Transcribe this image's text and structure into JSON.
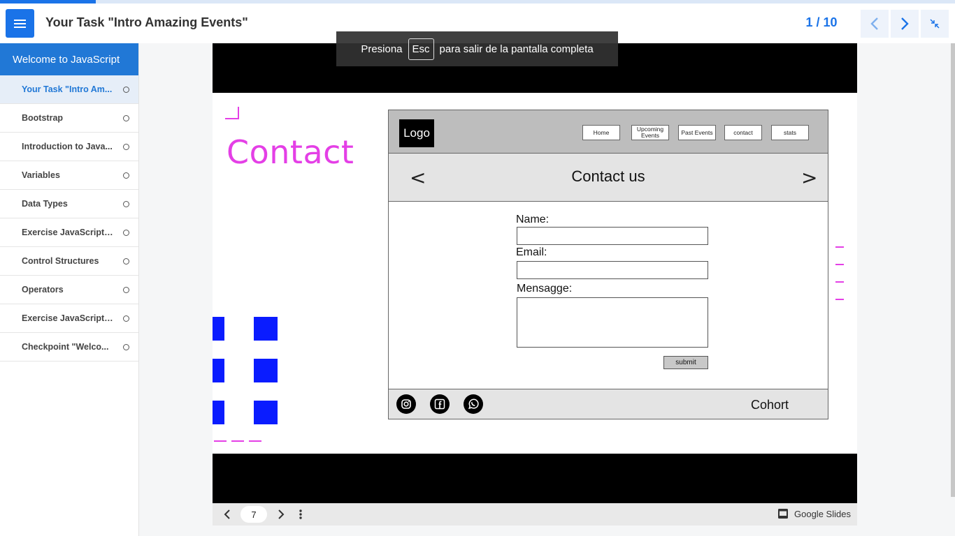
{
  "course_progress": {
    "value_percent": 10
  },
  "header": {
    "title": "Your Task \"Intro Amazing Events\"",
    "page_counter": "1 / 10",
    "menu_icon": "hamburger-menu-icon",
    "prev_icon": "chevron-left-icon",
    "next_icon": "chevron-right-icon",
    "exit_fullscreen_icon": "exit-fullscreen-icon"
  },
  "sidebar": {
    "section_title": "Welcome to JavaScript",
    "items": [
      {
        "label": "Your Task \"Intro Am...",
        "active": true
      },
      {
        "label": "Bootstrap",
        "active": false
      },
      {
        "label": "Introduction to Java...",
        "active": false
      },
      {
        "label": "Variables",
        "active": false
      },
      {
        "label": "Data Types",
        "active": false
      },
      {
        "label": "Exercise JavaScript ...",
        "active": false
      },
      {
        "label": "Control Structures",
        "active": false
      },
      {
        "label": "Operators",
        "active": false
      },
      {
        "label": "Exercise JavaScript ...",
        "active": false
      },
      {
        "label": "Checkpoint \"Welco...",
        "active": false
      }
    ]
  },
  "fullscreen_toast": {
    "before": "Presiona",
    "key": "Esc",
    "after": "para salir de la pantalla completa"
  },
  "slide": {
    "heading": "Contact",
    "accent_color": "#e43fe6",
    "square_color": "#0a1cff",
    "mockup": {
      "logo": "Logo",
      "nav": [
        "Home",
        "Upcoming Events",
        "Past Events",
        "contact",
        "stats"
      ],
      "hero_prev": "<",
      "hero_title": "Contact us",
      "hero_next": ">",
      "form": {
        "name_label": "Name:",
        "email_label": "Email:",
        "message_label": "Mensagge:",
        "submit": "submit"
      },
      "footer": {
        "icons": [
          "instagram-icon",
          "facebook-icon",
          "whatsapp-icon"
        ],
        "text": "Cohort"
      }
    }
  },
  "slides_toolbar": {
    "page": "7",
    "brand": "Google Slides"
  }
}
